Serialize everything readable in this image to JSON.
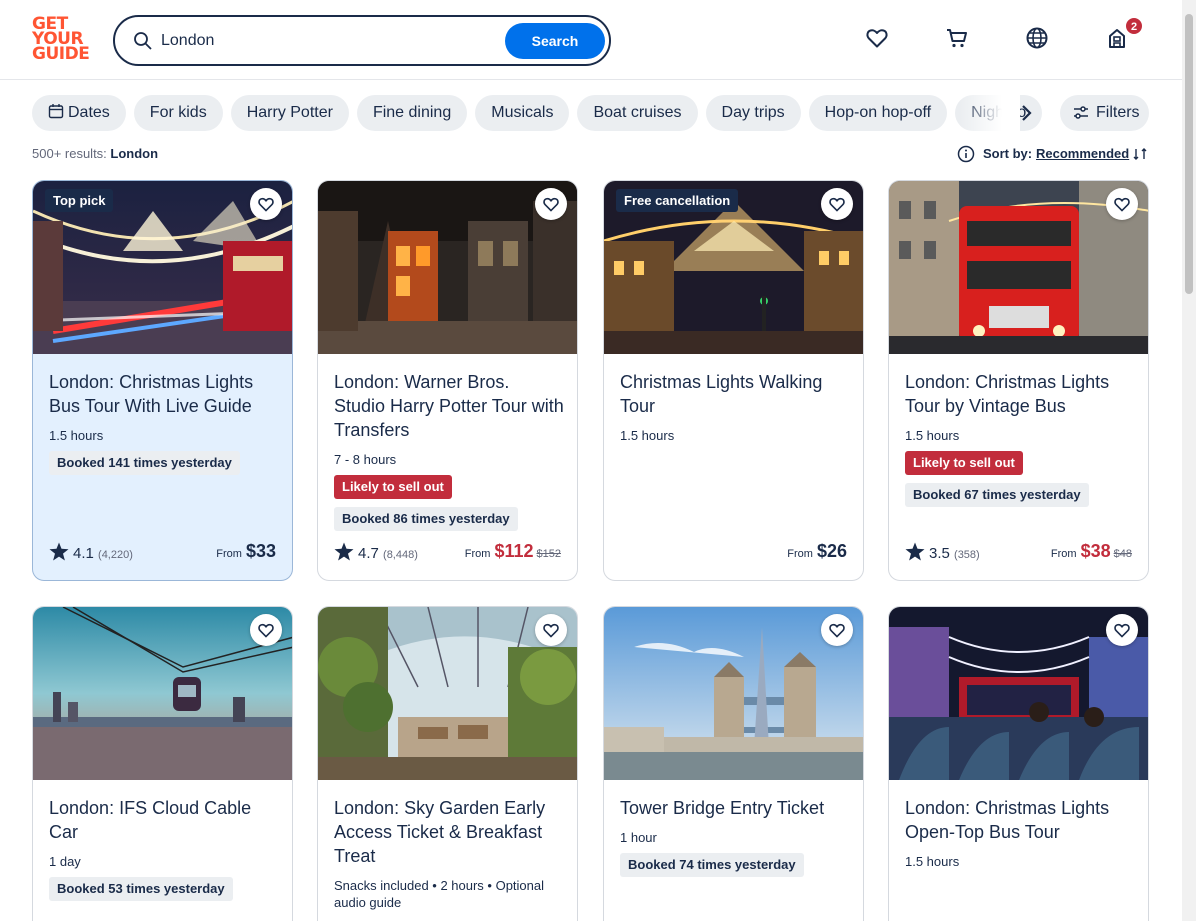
{
  "logo": {
    "line1": "GET",
    "line2": "YOUR",
    "line3": "GUIDE"
  },
  "search": {
    "value": "London",
    "button": "Search"
  },
  "header": {
    "cart_badge": "2"
  },
  "chips": [
    "Dates",
    "For kids",
    "Harry Potter",
    "Fine dining",
    "Musicals",
    "Boat cruises",
    "Day trips",
    "Hop-on hop-off",
    "Night to"
  ],
  "filters_label": "Filters",
  "results": {
    "count": "500+ results:",
    "query": "London"
  },
  "sort": {
    "label": "Sort by:",
    "value": "Recommended"
  },
  "cards": [
    {
      "tag": "Top pick",
      "title": "London: Christmas Lights Bus Tour With Live Guide",
      "duration": "1.5 hours",
      "booked": "Booked 141 times yesterday",
      "rating": "4.1",
      "reviews": "(4,220)",
      "from": "From",
      "price": "$33"
    },
    {
      "title": "London: Warner Bros. Studio Harry Potter Tour with Transfers",
      "duration": "7 - 8 hours",
      "alert": "Likely to sell out",
      "booked": "Booked 86 times yesterday",
      "rating": "4.7",
      "reviews": "(8,448)",
      "from": "From",
      "price": "$112",
      "old_price": "$152"
    },
    {
      "tag": "Free cancellation",
      "title": "Christmas Lights Walking Tour",
      "duration": "1.5 hours",
      "from": "From",
      "price": "$26"
    },
    {
      "title": "London: Christmas Lights Tour by Vintage Bus",
      "duration": "1.5 hours",
      "alert": "Likely to sell out",
      "booked": "Booked 67 times yesterday",
      "rating": "3.5",
      "reviews": "(358)",
      "from": "From",
      "price": "$38",
      "old_price": "$48"
    },
    {
      "title": "London: IFS Cloud Cable Car",
      "duration": "1 day",
      "booked": "Booked 53 times yesterday"
    },
    {
      "title": "London: Sky Garden Early Access Ticket & Breakfast Treat",
      "duration": "Snacks included • 2 hours • Optional audio guide"
    },
    {
      "title": "Tower Bridge Entry Ticket",
      "duration": "1 hour",
      "booked": "Booked 74 times yesterday"
    },
    {
      "title": "London: Christmas Lights Open-Top Bus Tour",
      "duration": "1.5 hours"
    }
  ],
  "colors": {
    "brand": "#ff5533",
    "primary": "#0071eb",
    "alert": "#c22d3c",
    "text": "#1a2b49"
  }
}
